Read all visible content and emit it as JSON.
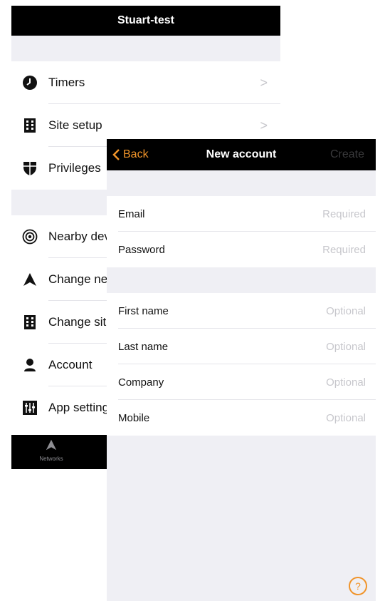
{
  "background": {
    "title": "Stuart-test",
    "menu": [
      {
        "label": "Timers",
        "icon": "clock-icon"
      },
      {
        "label": "Site setup",
        "icon": "building-icon"
      },
      {
        "label": "Privileges",
        "icon": "shield-icon"
      },
      {
        "label": "Nearby devices",
        "icon": "radar-icon"
      },
      {
        "label": "Change network",
        "icon": "network-icon"
      },
      {
        "label": "Change site",
        "icon": "building-icon"
      },
      {
        "label": "Account",
        "icon": "user-icon"
      },
      {
        "label": "App settings",
        "icon": "sliders-icon"
      }
    ],
    "tab_label": "Networks"
  },
  "modal": {
    "back_label": "Back",
    "title": "New account",
    "create_label": "Create",
    "fields": [
      {
        "label": "Email",
        "placeholder": "Required"
      },
      {
        "label": "Password",
        "placeholder": "Required"
      },
      {
        "label": "First name",
        "placeholder": "Optional"
      },
      {
        "label": "Last name",
        "placeholder": "Optional"
      },
      {
        "label": "Company",
        "placeholder": "Optional"
      },
      {
        "label": "Mobile",
        "placeholder": "Optional"
      }
    ],
    "help_symbol": "?"
  },
  "colors": {
    "accent": "#f0942a",
    "nav_bar": "#000000",
    "grouped_bg": "#efeff4",
    "placeholder": "#c7c7cc"
  }
}
